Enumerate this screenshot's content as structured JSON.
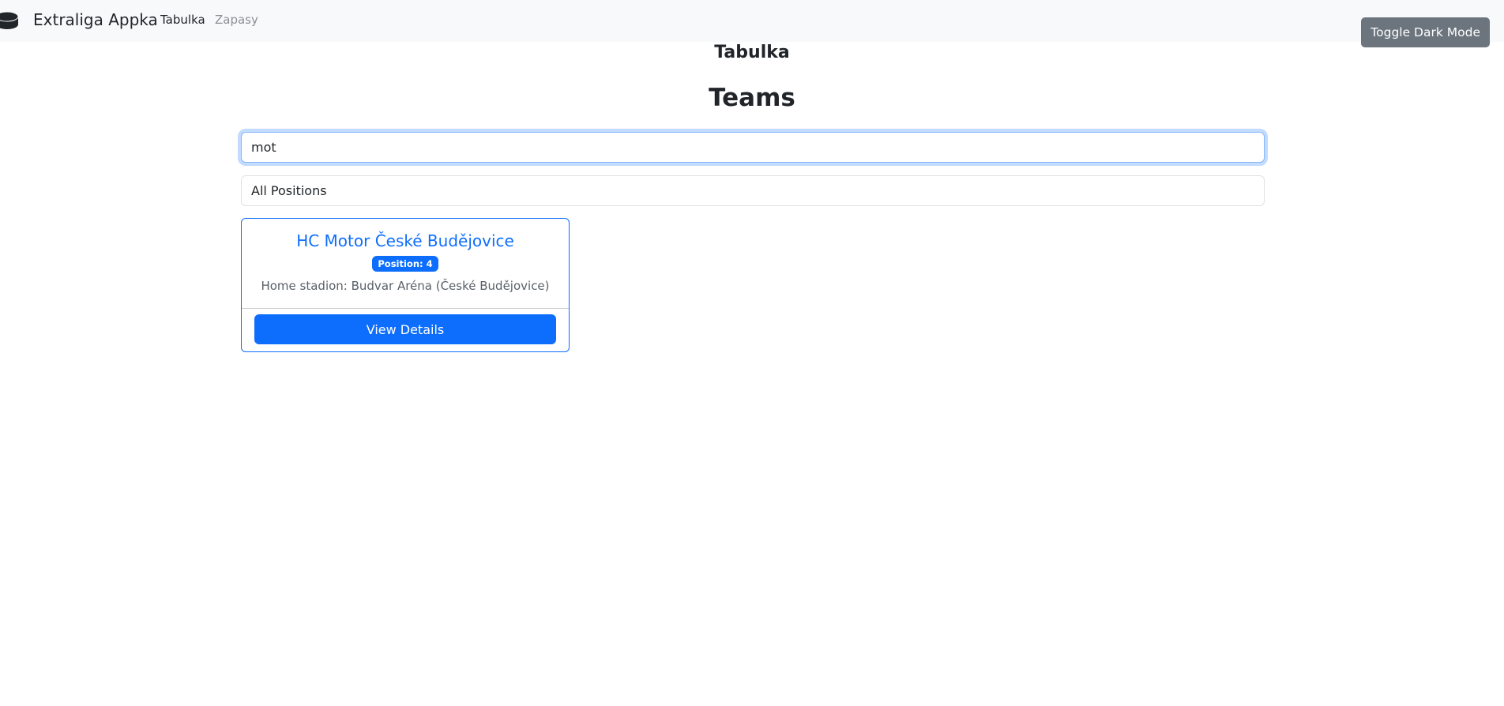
{
  "navbar": {
    "brand_icon": "hockey-puck-icon",
    "brand": "Extraliga Appka",
    "links": [
      {
        "label": "Tabulka",
        "active": true
      },
      {
        "label": "Zapasy",
        "active": false
      }
    ],
    "toggle_label": "Toggle Dark Mode"
  },
  "page": {
    "subtitle": "Tabulka",
    "heading": "Teams"
  },
  "search": {
    "value": "mot"
  },
  "filter": {
    "selected": "All Positions"
  },
  "teams": [
    {
      "name": "HC Motor České Budějovice",
      "position": "Position: 4",
      "stadium": "Home stadion: Budvar Aréna (České Budějovice)",
      "button_label": "View Details"
    }
  ],
  "colors": {
    "primary": "#0d6efd",
    "secondary": "#6c757d",
    "navbar_bg": "#f8f9fa"
  }
}
